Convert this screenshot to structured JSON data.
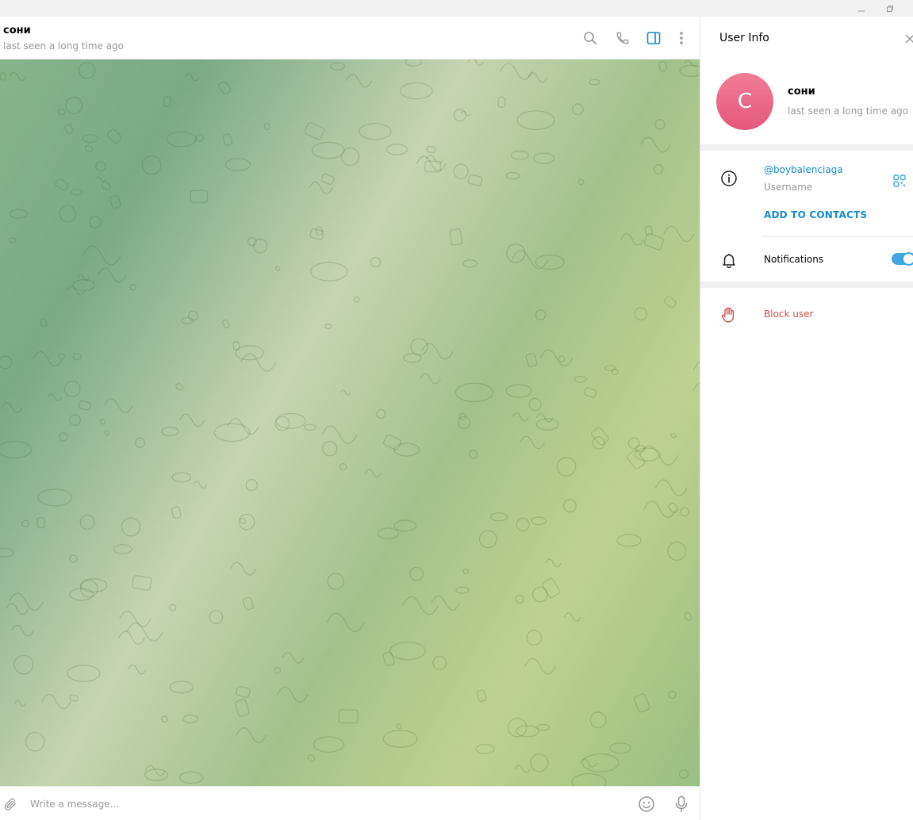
{
  "chat": {
    "title": "сони",
    "status": "last seen a long time ago"
  },
  "header_icons": [
    "search-icon",
    "phone-icon",
    "sidebar-toggle-icon",
    "more-vertical-icon"
  ],
  "composer": {
    "placeholder": "Write a message...",
    "icons": [
      "attach-icon",
      "emoji-icon",
      "microphone-icon"
    ]
  },
  "user_info": {
    "title": "User Info",
    "avatar_letter": "С",
    "name": "сони",
    "status": "last seen a long time ago",
    "username": "@boybalenciaga",
    "username_label": "Username",
    "add_contacts": "ADD TO CONTACTS",
    "notifications_label": "Notifications",
    "notifications_on": true,
    "block_label": "Block user"
  },
  "colors": {
    "accent": "#168acd",
    "toggle": "#40a7e3",
    "danger": "#d14e4e",
    "avatar_top": "#f17d97",
    "avatar_bottom": "#e5587b"
  }
}
